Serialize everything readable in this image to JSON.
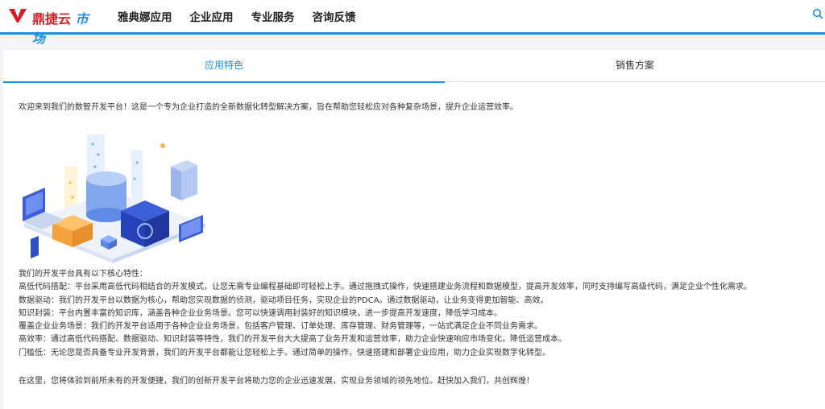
{
  "header": {
    "logo": {
      "text_a": "鼎捷云",
      "text_b": "市场"
    },
    "nav": [
      {
        "label": "雅典娜应用"
      },
      {
        "label": "企业应用"
      },
      {
        "label": "专业服务"
      },
      {
        "label": "咨询反馈"
      }
    ],
    "search_icon": "search-icon",
    "accent_color": "#1e8fe1",
    "brand_red": "#d41d24"
  },
  "tabs": {
    "active": "应用特色",
    "inactive": "销售方案"
  },
  "content": {
    "intro": "欢迎来到我们的数智开发平台！这是一个专为企业打造的全新数据化转型解决方案，旨在帮助您轻松应对各种复杂场景，提升企业运营效率。",
    "features_heading": "我们的开发平台具有以下核心特性：",
    "features": [
      "高低代码搭配：平台采用高低代码相结合的开发模式，让您无需专业编程基础即可轻松上手。通过拖拽式操作，快速搭建业务流程和数据模型，提高开发效率，同时支持编写高级代码，满足企业个性化需求。",
      "数据驱动：我们的开发平台以数据为核心，帮助您实现数据的侦测，驱动项目任务，实现企业的PDCA。通过数据驱动，让业务变得更加智能、高效。",
      "知识封装：平台内置丰富的知识库，涵盖各种企业业务场景。您可以快速调用封装好的知识模块，进一步提高开发速度，降低学习成本。",
      "覆盖企业业务场景：我们的开发平台适用于各种企业业务场景，包括客户管理、订单处理、库存管理、财务管理等，一站式满足企业不同业务需求。",
      "高效率：通过高低代码搭配、数据驱动、知识封装等特性，我们的开发平台大大提高了业务开发和运营效率，助力企业快速响应市场变化，降低运营成本。",
      "门槛低：无论您是否具备专业开发背景，我们的开发平台都能让您轻松上手。通过简单的操作，快速搭建和部署企业应用，助力企业实现数字化转型。"
    ],
    "outro": "在这里，您将体验到前所未有的开发便捷，我们的创新开发平台将助力您的企业迅速发展，实现业务领域的领先地位。赶快加入我们，共创辉煌！"
  }
}
